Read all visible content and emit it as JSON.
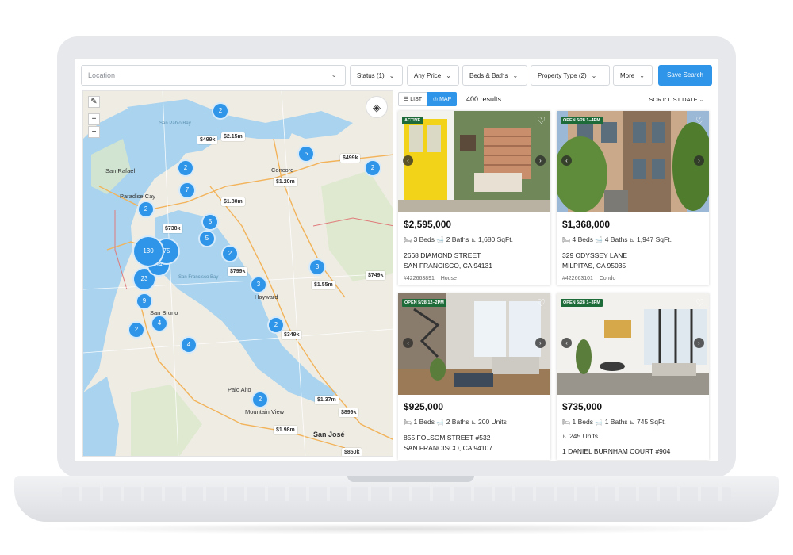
{
  "filters": {
    "location_placeholder": "Location",
    "status": "Status (1)",
    "price": "Any Price",
    "beds_baths": "Beds & Baths",
    "property_type": "Property Type (2)",
    "more": "More",
    "save_search": "Save Search"
  },
  "map": {
    "zoom_in": "+",
    "zoom_out": "−",
    "clusters": [
      "2",
      "2",
      "5",
      "2",
      "7",
      "2",
      "5",
      "5",
      "2",
      "3",
      "3",
      "2",
      "4",
      "4",
      "2",
      "9",
      "23",
      "94",
      "75",
      "130",
      "2"
    ],
    "prices": [
      "$2.15m",
      "$499k",
      "$499k",
      "$1.20m",
      "$1.80m",
      "$738k",
      "$799k",
      "$1.55m",
      "$749k",
      "$349k",
      "$1.37m",
      "$899k",
      "$1.98m",
      "$850k"
    ],
    "cities": [
      "Concord",
      "San Rafael",
      "Paradise Cay",
      "Hayward",
      "San Bruno",
      "Palo Alto",
      "Mountain View",
      "San José",
      "San Pablo Bay",
      "San Francisco Bay"
    ]
  },
  "results": {
    "view_list": "LIST",
    "view_map": "MAP",
    "count": "400 results",
    "sort": "SORT: LIST DATE"
  },
  "listings": [
    {
      "badge": "ACTIVE",
      "price": "$2,595,000",
      "beds": "3 Beds",
      "baths": "2 Baths",
      "size": "1,680 SqFt.",
      "street": "2668 DIAMOND STREET",
      "city": "SAN FRANCISCO, CA 94131",
      "mls": "#422663891",
      "type": "House"
    },
    {
      "badge": "OPEN 5/28 1–4PM",
      "price": "$1,368,000",
      "beds": "4 Beds",
      "baths": "4 Baths",
      "size": "1,947 SqFt.",
      "street": "329 ODYSSEY LANE",
      "city": "MILPITAS, CA 95035",
      "mls": "#422663101",
      "type": "Condo"
    },
    {
      "badge": "OPEN 5/28 12–2PM",
      "price": "$925,000",
      "beds": "1 Beds",
      "baths": "2 Baths",
      "size": "200 Units",
      "street": "855 FOLSOM STREET #532",
      "city": "SAN FRANCISCO, CA 94107"
    },
    {
      "badge": "OPEN 5/28 1–3PM",
      "price": "$735,000",
      "beds": "1 Beds",
      "baths": "1 Baths",
      "size": "745 SqFt.",
      "units": "245 Units",
      "street": "1 DANIEL BURNHAM COURT #904"
    }
  ],
  "colors": {
    "accent": "#2f95e8",
    "badge_green": "#1e6b3a",
    "water": "#a9d3ee",
    "land": "#efece4"
  }
}
